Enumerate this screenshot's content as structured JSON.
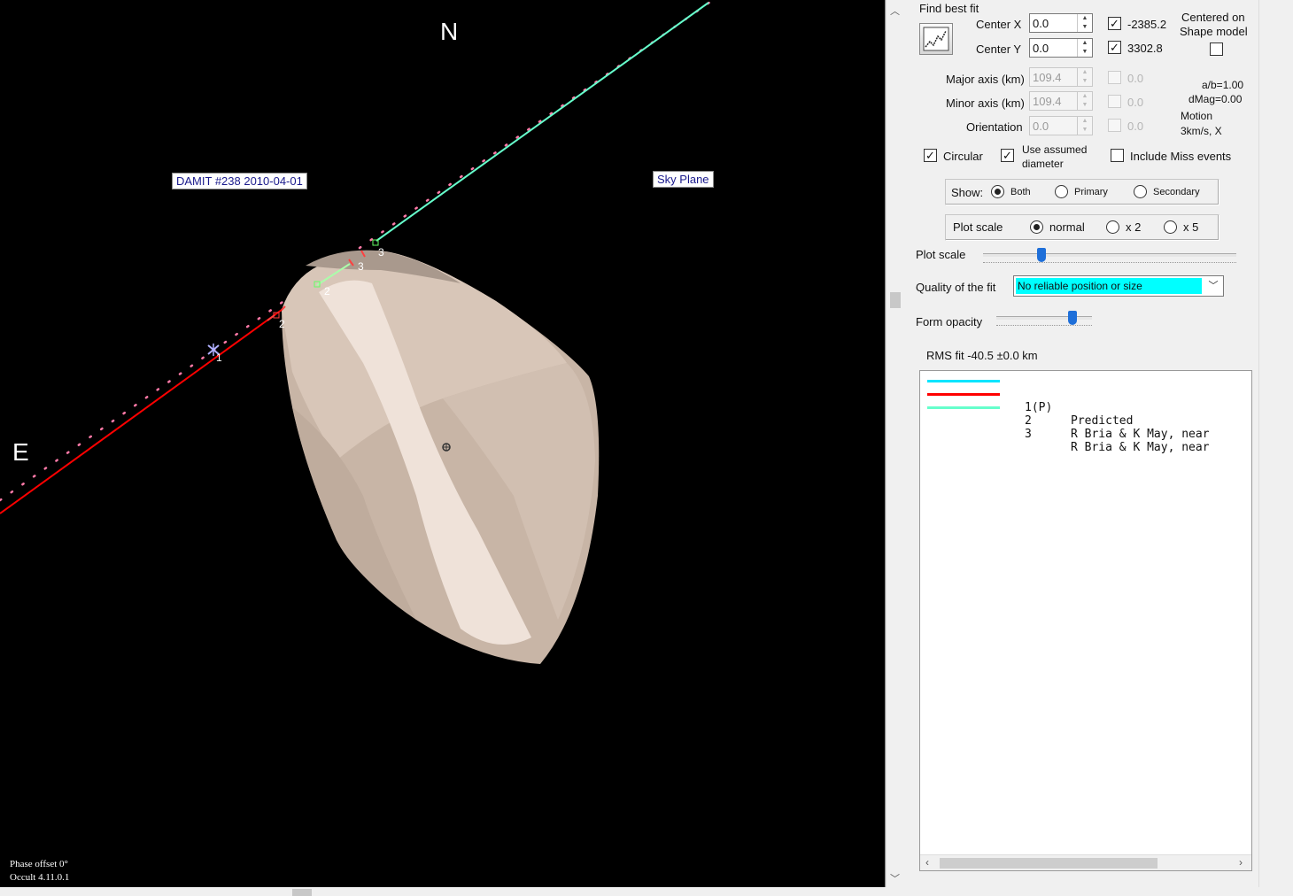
{
  "plot": {
    "north": "N",
    "east": "E",
    "tag_model": "DAMIT #238 2010-04-01",
    "tag_plane": "Sky Plane",
    "footer_phase": "Phase offset 0°",
    "footer_version": "Occult 4.11.0.1",
    "chord_labels": [
      "1",
      "2",
      "3",
      "2",
      "3"
    ]
  },
  "panel": {
    "find_best_fit": "Find best fit",
    "center_x_label": "Center X",
    "center_x_value": "0.0",
    "center_y_label": "Center Y",
    "center_y_value": "0.0",
    "center_x_check_value": "-2385.2",
    "center_y_check_value": "3302.8",
    "centered_on_line1": "Centered on",
    "centered_on_line2": "Shape model",
    "major_axis_label": "Major axis (km)",
    "major_axis_value": "109.4",
    "minor_axis_label": "Minor axis (km)",
    "minor_axis_value": "109.4",
    "orientation_label": "Orientation",
    "orientation_value": "0.0",
    "disabled_check_value": "0.0",
    "ab_ratio": "a/b=1.00",
    "dmag": "dMag=0.00",
    "motion_label": "Motion",
    "motion_value": "3km/s, X",
    "circular_label": "Circular",
    "use_assumed_line1": "Use assumed",
    "use_assumed_line2": "diameter",
    "include_miss_label": "Include Miss events",
    "show_label": "Show:",
    "show_options": [
      "Both",
      "Primary",
      "Secondary"
    ],
    "plot_scale_options_label": "Plot scale",
    "plot_scale_options": [
      "normal",
      "x 2",
      "x 5"
    ],
    "plot_scale_slider_label": "Plot scale",
    "plot_scale_slider_value": 0.23,
    "quality_label": "Quality of the fit",
    "quality_value": "No reliable position or size",
    "form_opacity_label": "Form opacity",
    "form_opacity_value": 0.75,
    "rms_fit": "RMS fit -40.5 ±0.0 km",
    "events": [
      {
        "color": "#00e5ff",
        "num": "1(P)",
        "text": "Predicted"
      },
      {
        "color": "#ff0000",
        "num": "2",
        "text": "R Bria & K May, near"
      },
      {
        "color": "#66ffcc",
        "num": "3",
        "text": "R Bria & K May, near"
      }
    ]
  }
}
